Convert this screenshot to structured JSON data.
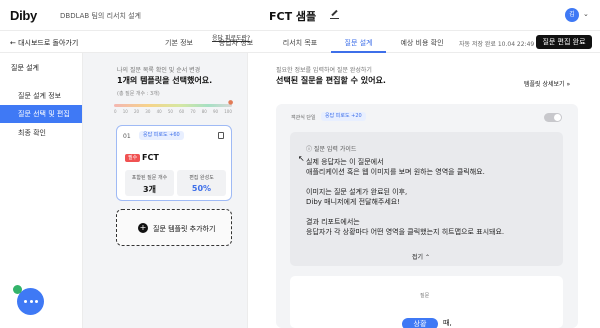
{
  "app": {
    "logo": "Diby",
    "subtitle": "DBDLAB 팀의 리서치 설계",
    "page_title": "FCT 샘플",
    "avatar_initial": "김"
  },
  "nav": {
    "back_label": "대시보드로 돌아가기",
    "tabs": [
      {
        "label": "기본 정보",
        "active": false
      },
      {
        "label": "응답자 정보",
        "active": false
      },
      {
        "label": "리서치 목표",
        "active": false
      },
      {
        "label": "질문 설계",
        "active": true
      },
      {
        "label": "예상 비용 확인",
        "active": false
      }
    ],
    "saved_text": "자동 저장 완료 10.04 22:49",
    "complete_button": "질문 편집 완료"
  },
  "sidebar": {
    "heading": "질문 설계",
    "items": [
      {
        "label": "질문 설계 정보",
        "active": false
      },
      {
        "label": "질문 선택 및 편집",
        "active": true
      },
      {
        "label": "최종 확인",
        "active": false
      }
    ]
  },
  "middle": {
    "small_text": "나의 질문 목록 확인 및 순서 변경",
    "title": "1개의 템플릿을 선택했어요.",
    "guide_link": "응답 피로도란?",
    "count_text": "(총 질문 개수 : 3개)",
    "fatigue_ticks": [
      "0",
      "10",
      "20",
      "30",
      "40",
      "50",
      "60",
      "70",
      "80",
      "90",
      "100"
    ],
    "fatigue_level": 0.12,
    "card": {
      "number": "01",
      "badge": "응답 피로도 +60",
      "tag": "필수",
      "name": "FCT",
      "stat1_label": "포함된 질문 개수",
      "stat1_value": "3개",
      "stat2_label": "편집 완성도",
      "stat2_value": "50%"
    },
    "add_button": "질문 템플릿 추가하기"
  },
  "right": {
    "small_text": "필요한 정보를 입력하여 질문 완성하기",
    "title": "선택된 질문을 편집할 수 있어요.",
    "detail_link": "템플릿 상세보기",
    "question": {
      "type": "객관식 단일",
      "badge": "응답 피로도 +20",
      "guide_heading": "질문 입력 가이드",
      "guide_lines": [
        "실제 응답자는 이 질문에서",
        "애플리케이션 혹은 웹 이미지를 보며 원하는 영역을 클릭해요.",
        "",
        "이미지는 질문 설계가 완료된 이후,",
        "Diby 매니저에게 전달해주세요!",
        "",
        "결과 리포트에서는",
        "응답자가 각 상황마다 어떤 영역을 클릭했는지 히트맵으로 표시돼요."
      ],
      "fold_label": "접기",
      "question_label": "질문",
      "pill": "상황",
      "after_pill": "때,"
    }
  }
}
